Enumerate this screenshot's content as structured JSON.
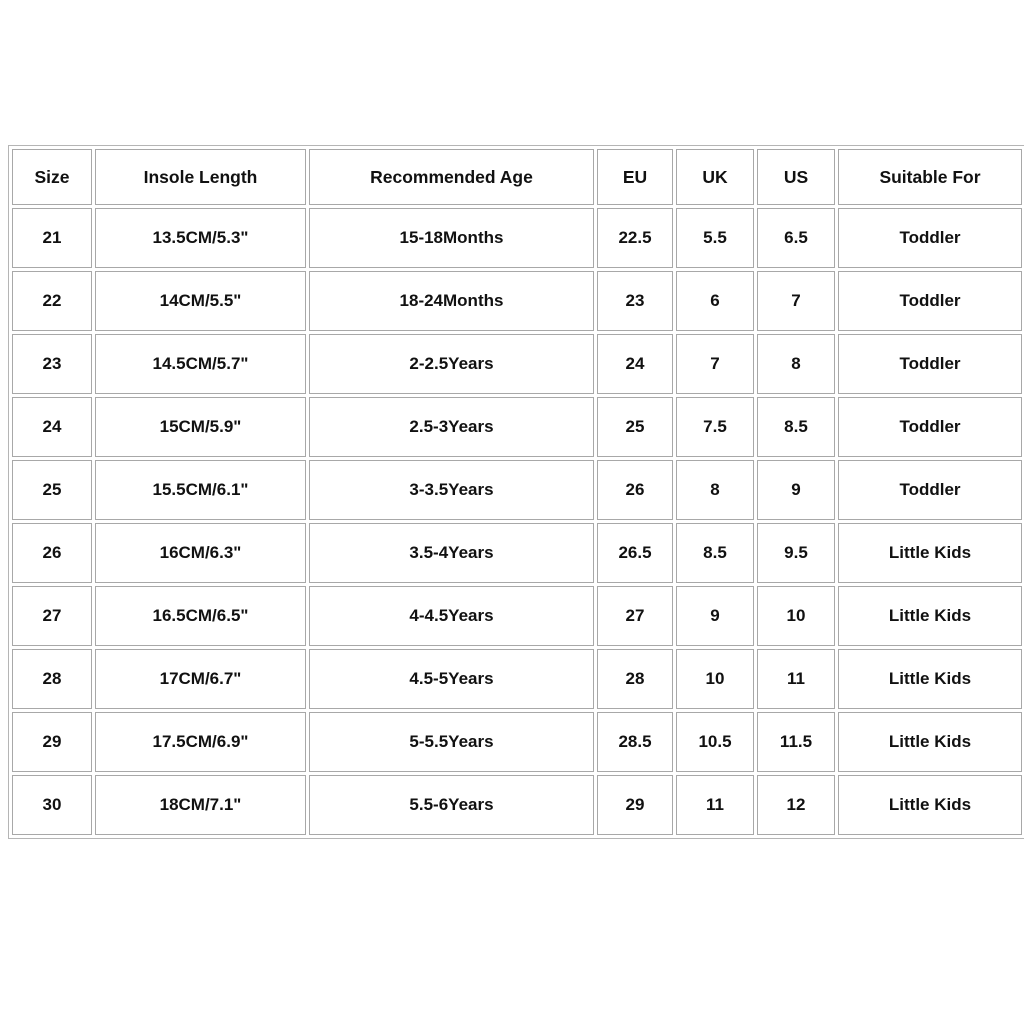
{
  "page": {
    "background_color": "#ffffff",
    "text_color": "#111111",
    "border_color": "#a8a8a8"
  },
  "table": {
    "name": "shoe-size-chart",
    "columns": [
      {
        "key": "size",
        "label": "Size"
      },
      {
        "key": "insole",
        "label": "Insole Length"
      },
      {
        "key": "age",
        "label": "Recommended Age"
      },
      {
        "key": "eu",
        "label": "EU"
      },
      {
        "key": "uk",
        "label": "UK"
      },
      {
        "key": "us",
        "label": "US"
      },
      {
        "key": "suit",
        "label": "Suitable For"
      }
    ],
    "rows": [
      {
        "size": "21",
        "insole": "13.5CM/5.3\"",
        "age": "15-18Months",
        "eu": "22.5",
        "uk": "5.5",
        "us": "6.5",
        "suit": "Toddler"
      },
      {
        "size": "22",
        "insole": "14CM/5.5\"",
        "age": "18-24Months",
        "eu": "23",
        "uk": "6",
        "us": "7",
        "suit": "Toddler"
      },
      {
        "size": "23",
        "insole": "14.5CM/5.7\"",
        "age": "2-2.5Years",
        "eu": "24",
        "uk": "7",
        "us": "8",
        "suit": "Toddler"
      },
      {
        "size": "24",
        "insole": "15CM/5.9\"",
        "age": "2.5-3Years",
        "eu": "25",
        "uk": "7.5",
        "us": "8.5",
        "suit": "Toddler"
      },
      {
        "size": "25",
        "insole": "15.5CM/6.1\"",
        "age": "3-3.5Years",
        "eu": "26",
        "uk": "8",
        "us": "9",
        "suit": "Toddler"
      },
      {
        "size": "26",
        "insole": "16CM/6.3\"",
        "age": "3.5-4Years",
        "eu": "26.5",
        "uk": "8.5",
        "us": "9.5",
        "suit": "Little Kids"
      },
      {
        "size": "27",
        "insole": "16.5CM/6.5\"",
        "age": "4-4.5Years",
        "eu": "27",
        "uk": "9",
        "us": "10",
        "suit": "Little Kids"
      },
      {
        "size": "28",
        "insole": "17CM/6.7\"",
        "age": "4.5-5Years",
        "eu": "28",
        "uk": "10",
        "us": "11",
        "suit": "Little Kids"
      },
      {
        "size": "29",
        "insole": "17.5CM/6.9\"",
        "age": "5-5.5Years",
        "eu": "28.5",
        "uk": "10.5",
        "us": "11.5",
        "suit": "Little Kids"
      },
      {
        "size": "30",
        "insole": "18CM/7.1\"",
        "age": "5.5-6Years",
        "eu": "29",
        "uk": "11",
        "us": "12",
        "suit": "Little Kids"
      }
    ]
  }
}
